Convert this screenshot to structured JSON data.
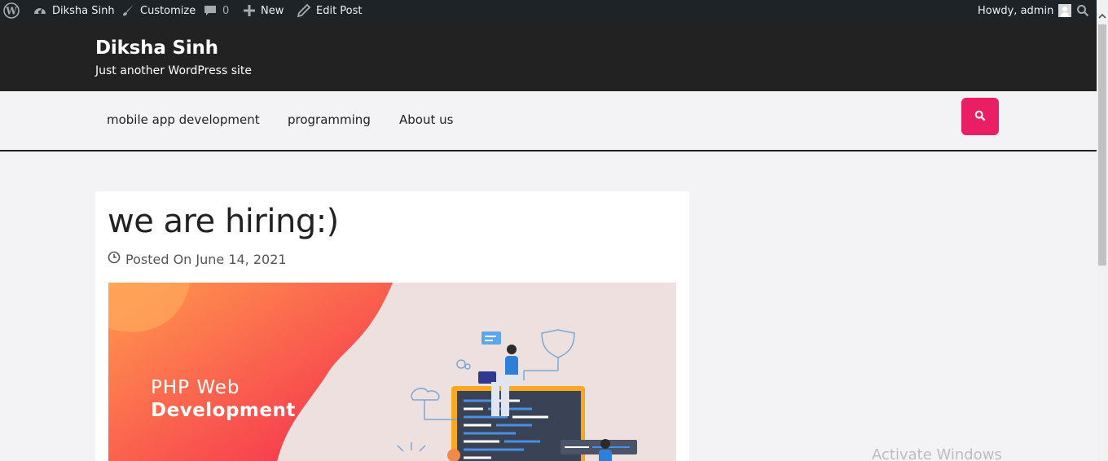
{
  "adminbar": {
    "site_name": "Diksha Sinh",
    "customize": "Customize",
    "comments_count": "0",
    "new_label": "New",
    "edit_post": "Edit Post",
    "howdy": "Howdy, admin"
  },
  "header": {
    "site_title": "Diksha Sinh",
    "tagline": "Just another WordPress site"
  },
  "nav": {
    "items": [
      "mobile app development",
      "programming",
      "About us"
    ]
  },
  "post": {
    "title": "we are hiring:)",
    "meta": "Posted On June 14, 2021",
    "image": {
      "line1": "PHP Web",
      "line2": "Development"
    }
  },
  "watermark": "Activate Windows",
  "colors": {
    "adminbar": "#1d2327",
    "header": "#222222",
    "accent": "#e91e63",
    "page_bg": "#f3f3f6"
  },
  "icons": [
    "wordpress-icon",
    "dashboard-icon",
    "brush-icon",
    "comment-icon",
    "plus-icon",
    "pencil-icon",
    "search-icon",
    "clock-icon"
  ]
}
